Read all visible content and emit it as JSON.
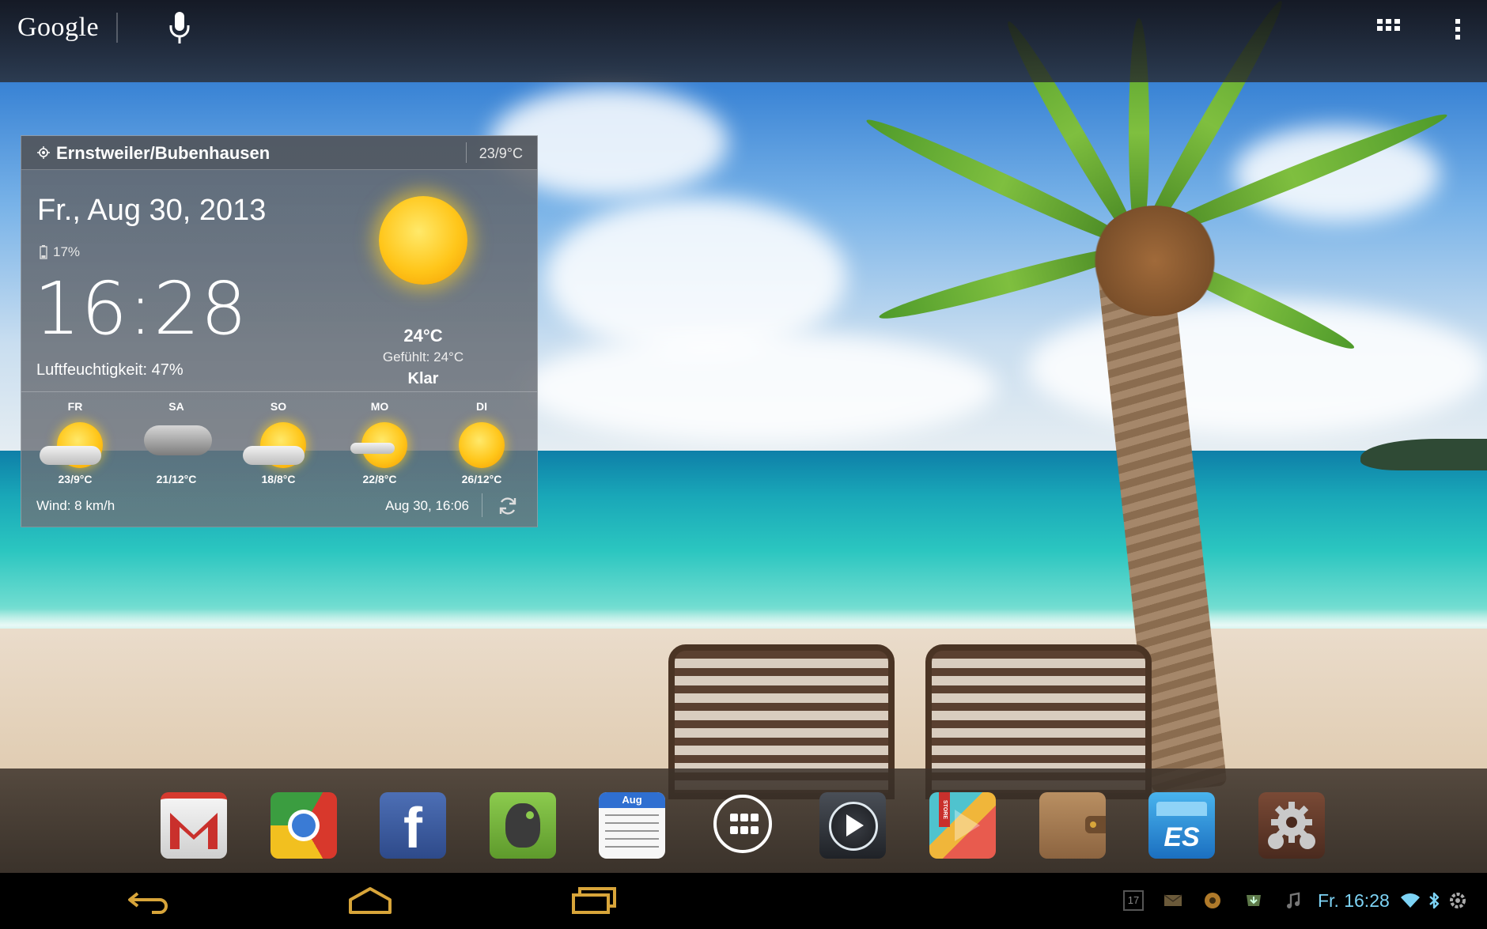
{
  "topbar": {
    "logo_text": "Google",
    "mic_icon": "mic-icon",
    "apps_icon": "apps-grid-icon",
    "menu_icon": "overflow-menu-icon"
  },
  "weather": {
    "location": "Ernstweiler/Bubenhausen",
    "today_hilo": "23/9°C",
    "date": "Fr., Aug 30, 2013",
    "battery": "17%",
    "time": "16:28",
    "humidity": "Luftfeuchtigkeit: 47%",
    "temperature": "24°C",
    "feels_like": "Gefühlt: 24°C",
    "condition": "Klar",
    "condition_icon": "sunny-icon",
    "forecast": [
      {
        "day": "FR",
        "temp": "23/9°C",
        "icon": "partly-cloudy-icon"
      },
      {
        "day": "SA",
        "temp": "21/12°C",
        "icon": "cloudy-rain-icon"
      },
      {
        "day": "SO",
        "temp": "18/8°C",
        "icon": "partly-cloudy-icon"
      },
      {
        "day": "MO",
        "temp": "22/8°C",
        "icon": "partly-cloudy-icon"
      },
      {
        "day": "DI",
        "temp": "26/12°C",
        "icon": "sunny-icon"
      }
    ],
    "wind": "Wind: 8 km/h",
    "updated": "Aug 30, 16:06",
    "refresh_icon": "refresh-icon"
  },
  "dock": {
    "apps": [
      {
        "name": "Gmail",
        "icon": "gmail-icon"
      },
      {
        "name": "Chrome",
        "icon": "chrome-icon"
      },
      {
        "name": "Facebook",
        "icon": "facebook-icon",
        "glyph": "f"
      },
      {
        "name": "Evernote",
        "icon": "evernote-icon"
      },
      {
        "name": "Calendar",
        "icon": "calendar-icon",
        "month": "Aug"
      },
      {
        "name": "All apps",
        "icon": "app-drawer-icon"
      },
      {
        "name": "Play Music",
        "icon": "play-music-icon"
      },
      {
        "name": "Play Store",
        "icon": "play-store-icon",
        "badge": "STORE"
      },
      {
        "name": "Wallet",
        "icon": "wallet-icon"
      },
      {
        "name": "ES File Explorer",
        "icon": "es-file-explorer-icon",
        "glyph": "ES"
      },
      {
        "name": "Settings",
        "icon": "settings-gear-icon"
      }
    ]
  },
  "navbar": {
    "back_icon": "back-icon",
    "home_icon": "home-icon",
    "recents_icon": "recent-apps-icon",
    "status_clock": "Fr. 16:28",
    "status_icons": [
      "calendar-notification-icon",
      "email-notification-icon",
      "media-notification-icon",
      "download-notification-icon",
      "music-notification-icon",
      "wifi-icon",
      "bluetooth-icon",
      "settings-status-icon"
    ],
    "calendar_day": "17"
  },
  "colors": {
    "status_text": "#7dd3f5",
    "nav_icons": "#d8a53a",
    "sun": "#ffc61a"
  }
}
